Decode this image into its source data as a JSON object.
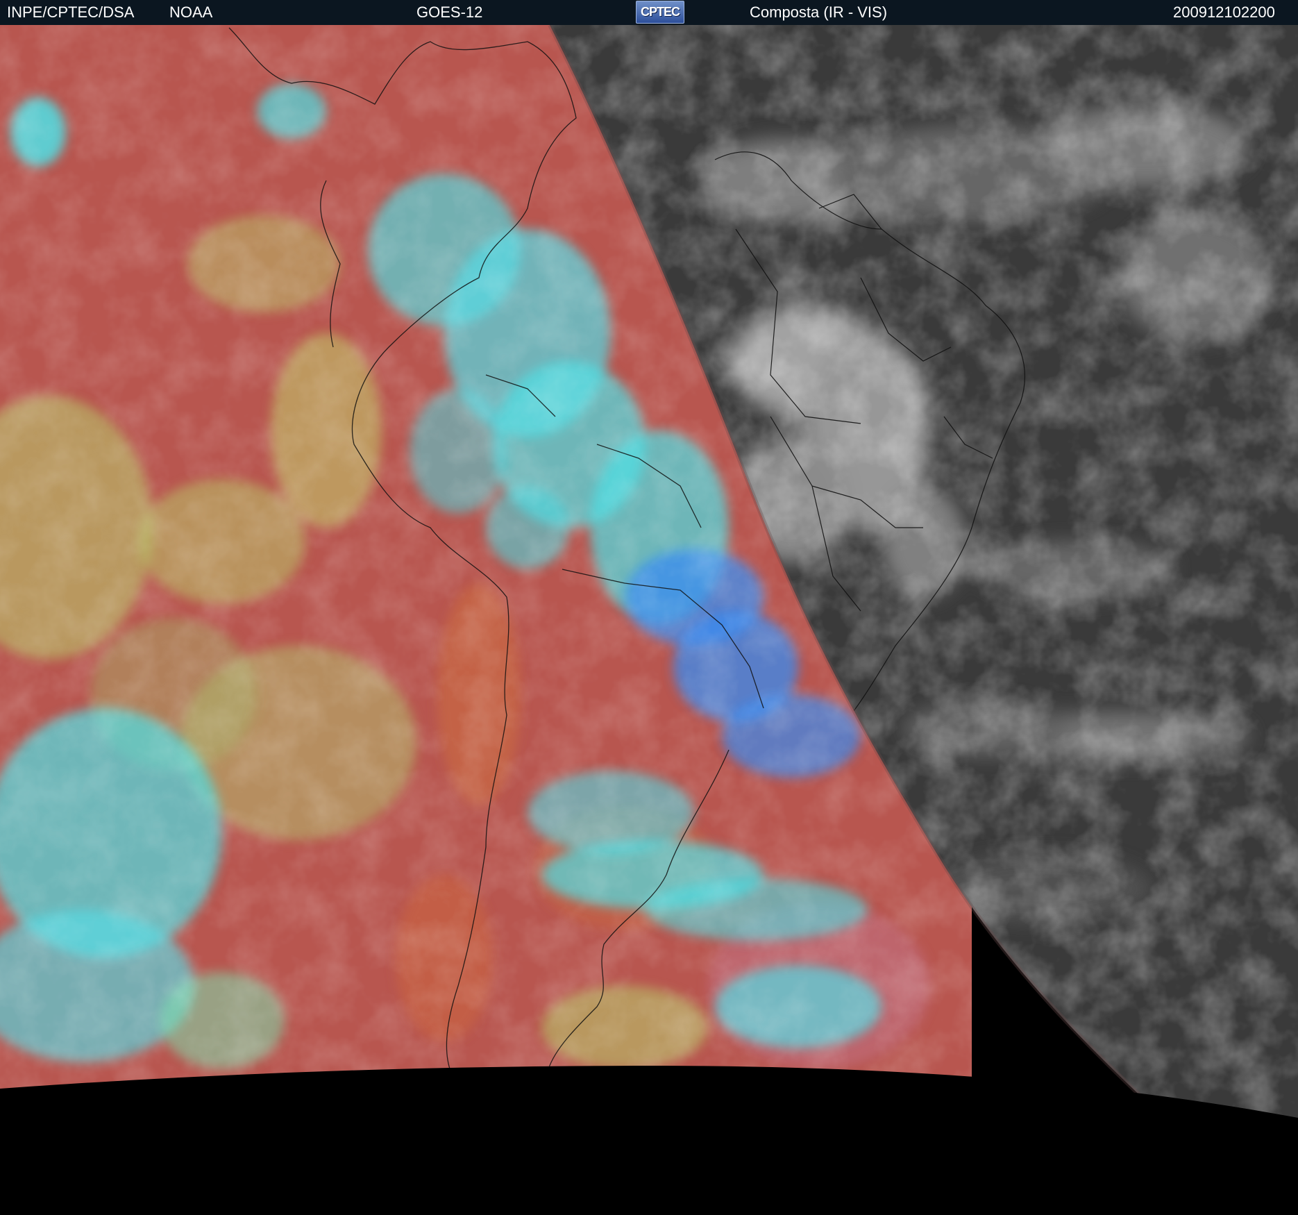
{
  "header": {
    "agency": "INPE/CPTEC/DSA",
    "source": "NOAA",
    "satellite": "GOES-12",
    "logo_text": "CPTEC",
    "product": "Composta (IR - VIS)",
    "timestamp": "200912102200"
  },
  "colors": {
    "header_background": "#0b1620",
    "header_text": "#ffffff",
    "ir_ocean_red": "#b8564f",
    "ir_low_cloud_green": "#b9c46a",
    "ir_high_cloud_cyan": "#4fe0e6",
    "ir_deep_cloud_blue": "#3a8cf0",
    "vis_night_gray": "#3b3b3b",
    "vis_cloud_white": "#d8d8d8",
    "space_black": "#000000"
  }
}
